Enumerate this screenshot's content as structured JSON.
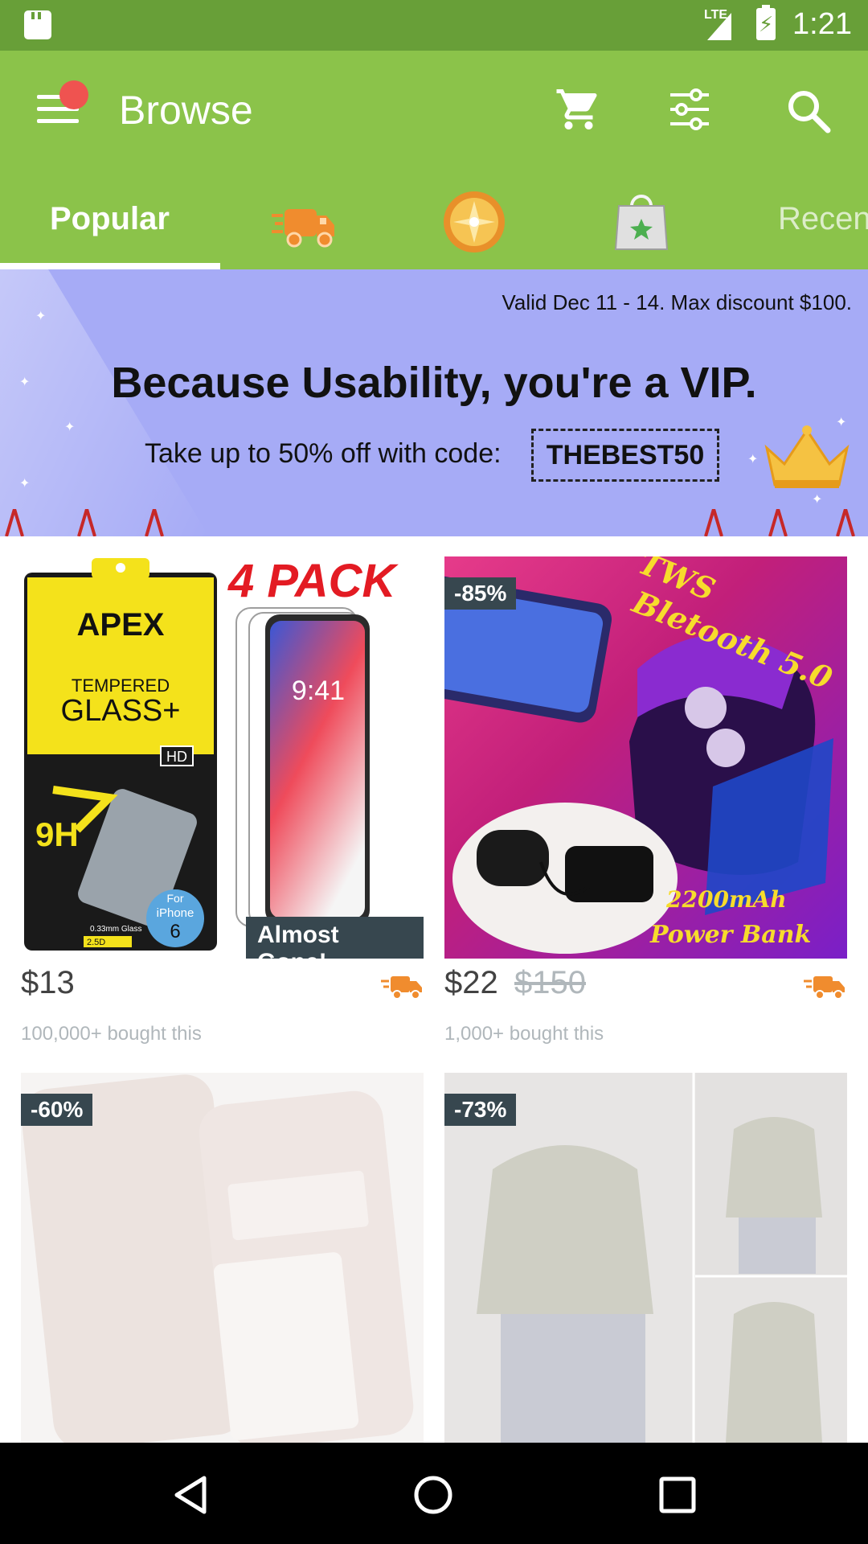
{
  "status_bar": {
    "network": "LTE",
    "time": "1:21"
  },
  "app_bar": {
    "title": "Browse"
  },
  "tabs": [
    {
      "label": "Popular",
      "selected": true
    },
    {
      "icon": "truck-icon"
    },
    {
      "icon": "coin-icon"
    },
    {
      "icon": "star-bag-icon"
    },
    {
      "label": "Recen"
    }
  ],
  "banner": {
    "validity": "Valid Dec 11 - 14. Max discount $100.",
    "headline": "Because Usability, you're a VIP.",
    "promo_text": "Take up to 50% off with code:",
    "code": "THEBEST50"
  },
  "products": [
    {
      "image_text": {
        "brand": "APEX",
        "line1": "TEMPERED",
        "line2": "GLASS+",
        "badge": "HD",
        "hardness": "9H",
        "pack": "4 PACK",
        "for": "For",
        "device": "iPhone",
        "model": "6",
        "thickness": "0.33mm Glass",
        "edges": "2.5D",
        "screen_time": "9:41"
      },
      "overlay": "Almost Gone!",
      "price": "$13",
      "bought": "100,000+ bought this"
    },
    {
      "image_text": {
        "line1": "TWS",
        "line2": "Bletooth 5.0",
        "line3": "2200mAh",
        "line4": "Power Bank"
      },
      "discount": "-85%",
      "price": "$22",
      "old_price": "$150",
      "bought": "1,000+ bought this"
    },
    {
      "discount": "-60%"
    },
    {
      "discount": "-73%"
    }
  ],
  "colors": {
    "status_bar": "#689f38",
    "app_bar": "#8bc34a",
    "banner": "#a6abf6",
    "badge": "#37474f",
    "shipping": "#f08c2e"
  }
}
